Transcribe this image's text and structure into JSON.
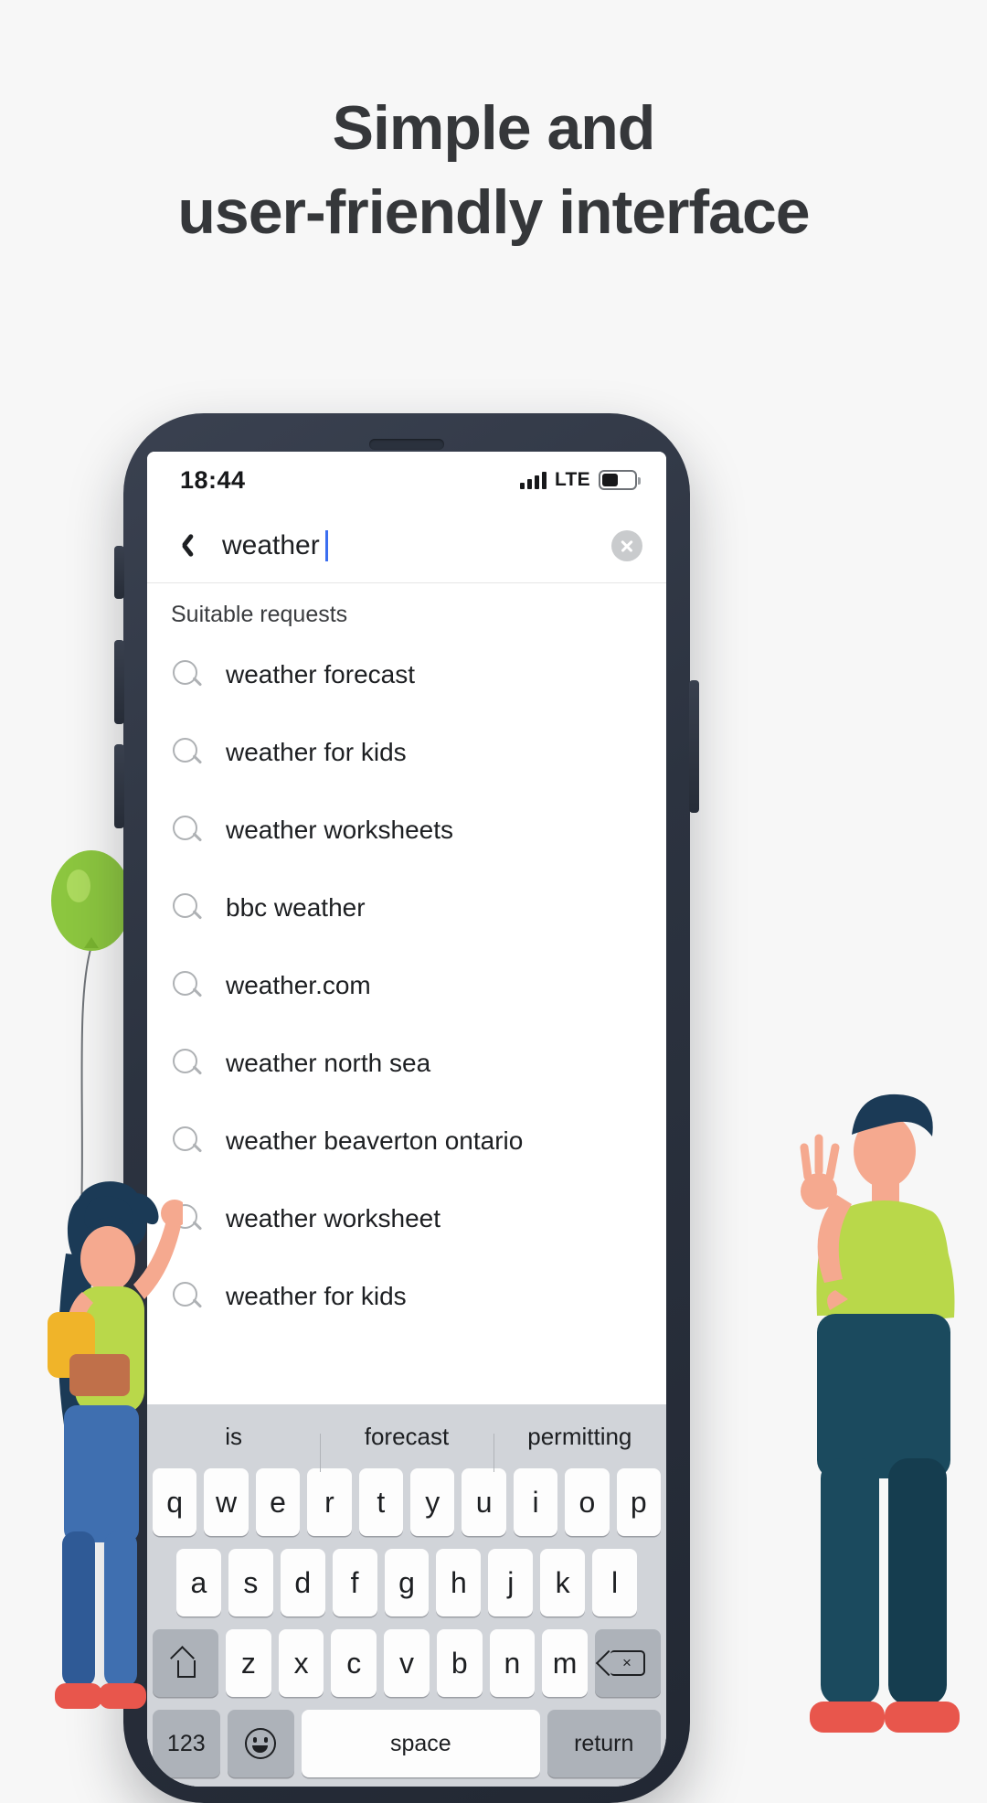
{
  "headline": {
    "line1": "Simple and",
    "line2": "user-friendly interface"
  },
  "phone": {
    "status": {
      "time": "18:44",
      "network": "LTE",
      "signal_bars": 4,
      "battery_percent": 50
    },
    "search": {
      "back_icon": "chevron-left-icon",
      "query": "weather",
      "clear_icon": "clear-circle-icon"
    },
    "suggestions": {
      "header": "Suitable requests",
      "items": [
        "weather forecast",
        "weather for kids",
        "weather worksheets",
        "bbc weather",
        "weather.com",
        "weather north sea",
        "weather beaverton ontario",
        "weather worksheet",
        "weather  for kids"
      ]
    },
    "keyboard": {
      "predictions": [
        "is",
        "forecast",
        "permitting"
      ],
      "row1": [
        "q",
        "w",
        "e",
        "r",
        "t",
        "y",
        "u",
        "i",
        "o",
        "p"
      ],
      "row2": [
        "a",
        "s",
        "d",
        "f",
        "g",
        "h",
        "j",
        "k",
        "l"
      ],
      "row3": [
        "z",
        "x",
        "c",
        "v",
        "b",
        "n",
        "m"
      ],
      "shift_icon": "shift-icon",
      "delete_icon": "backspace-icon",
      "numbers_label": "123",
      "emoji_icon": "emoji-icon",
      "space_label": "space",
      "return_label": "return"
    }
  },
  "colors": {
    "accent_caret": "#3b6ef0",
    "phone_body": "#2c3340",
    "keyboard_bg": "#d1d4d9",
    "balloon_green": "#8cc63f",
    "shirt_green": "#b9d84a",
    "pants_navy": "#1b4a5e"
  }
}
